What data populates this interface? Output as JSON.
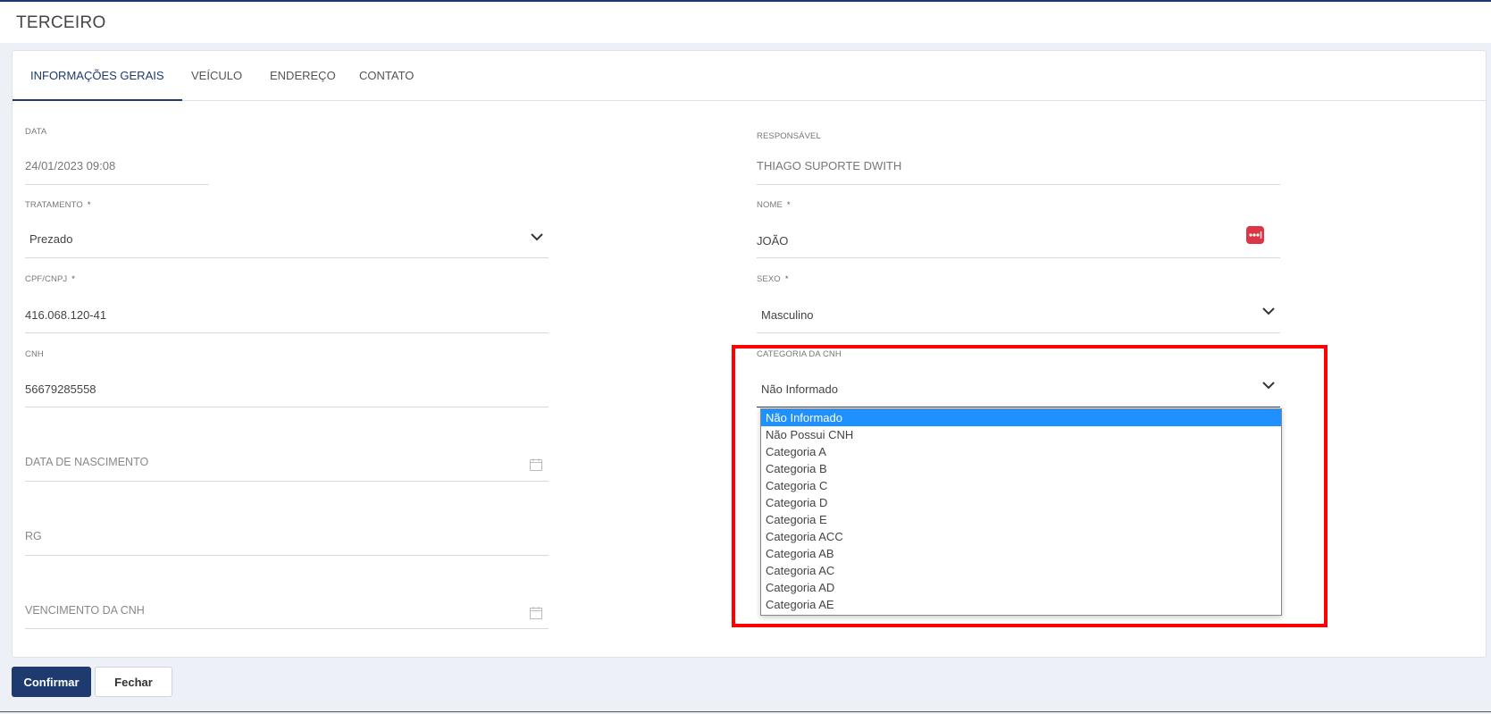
{
  "header": {
    "title": "TERCEIRO"
  },
  "tabs": [
    {
      "label": "INFORMAÇÕES GERAIS"
    },
    {
      "label": "VEÍCULO"
    },
    {
      "label": "ENDEREÇO"
    },
    {
      "label": "CONTATO"
    }
  ],
  "form": {
    "data": {
      "label": "DATA",
      "value": "24/01/2023 09:08"
    },
    "responsavel": {
      "label": "RESPONSÁVEL",
      "value": "THIAGO SUPORTE DWITH"
    },
    "tratamento": {
      "label": "TRATAMENTO",
      "value": "Prezado"
    },
    "nome": {
      "label": "NOME",
      "value": "JOÃO"
    },
    "cpf": {
      "label": "CPF/CNPJ",
      "value": "416.068.120-41"
    },
    "sexo": {
      "label": "SEXO",
      "value": "Masculino"
    },
    "cnh": {
      "label": "CNH",
      "value": "56679285558"
    },
    "categoria": {
      "label": "CATEGORIA DA CNH",
      "value": "Não Informado"
    },
    "nascimento": {
      "placeholder": "DATA DE NASCIMENTO"
    },
    "rg": {
      "placeholder": "RG"
    },
    "vencimento": {
      "placeholder": "VENCIMENTO DA CNH"
    },
    "required_mark": "*"
  },
  "dropdown": {
    "options": [
      "Não Informado",
      "Não Possui CNH",
      "Categoria A",
      "Categoria B",
      "Categoria C",
      "Categoria D",
      "Categoria E",
      "Categoria ACC",
      "Categoria AB",
      "Categoria AC",
      "Categoria AD",
      "Categoria AE"
    ],
    "selected_index": 0
  },
  "footer": {
    "confirm_label": "Confirmar",
    "close_label": "Fechar"
  },
  "colors": {
    "primary": "#1e3a6e",
    "highlight": "#1e90ff",
    "danger": "#dc3545",
    "annotation": "#ff0000"
  },
  "icons": {
    "select_arrow": "chevron-down-icon",
    "date_picker": "calendar-icon",
    "name_badge": "more-dots-icon"
  }
}
